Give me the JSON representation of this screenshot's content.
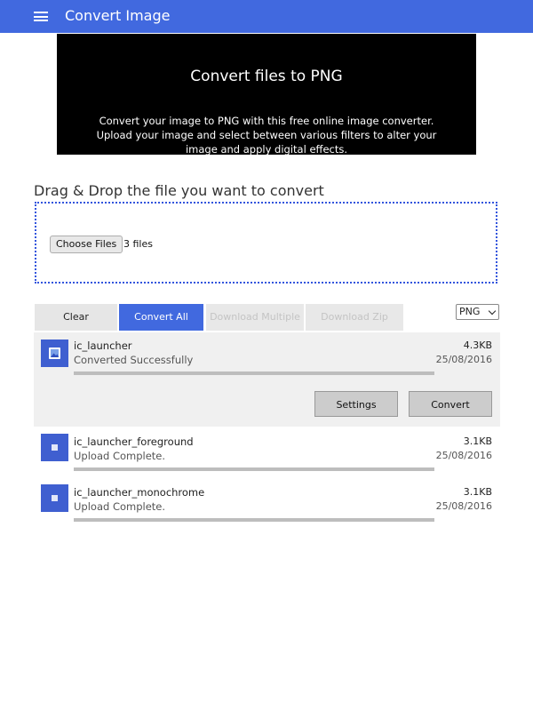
{
  "header": {
    "title": "Convert Image"
  },
  "hero": {
    "title": "Convert files to PNG",
    "description": "Convert your image to PNG with this free online image converter. Upload your image and select between various filters to alter your image and apply digital effects."
  },
  "dropzone": {
    "heading": "Drag & Drop the file you want to convert",
    "choose_label": "Choose Files",
    "files_count": "3 files"
  },
  "toolbar": {
    "clear": "Clear",
    "convert_all": "Convert All",
    "download_multiple": "Download Multiple",
    "download_zip": "Download Zip",
    "format": "PNG"
  },
  "files": [
    {
      "name": "ic_launcher",
      "status": "Converted Successfully",
      "size": "4.3KB",
      "date": "25/08/2016",
      "progress": 1.0,
      "settings_label": "Settings",
      "convert_label": "Convert"
    },
    {
      "name": "ic_launcher_foreground",
      "status": "Upload Complete.",
      "size": "3.1KB",
      "date": "25/08/2016",
      "progress": 1.0
    },
    {
      "name": "ic_launcher_monochrome",
      "status": "Upload Complete.",
      "size": "3.1KB",
      "date": "25/08/2016",
      "progress": 1.0
    }
  ],
  "colors": {
    "accent": "#4169df",
    "icon_bg": "#3f5fd0",
    "hero_bg": "#000000"
  },
  "icons": {
    "menu": "hamburger-icon",
    "file": "image-icon",
    "select": "chevron-down-icon"
  }
}
